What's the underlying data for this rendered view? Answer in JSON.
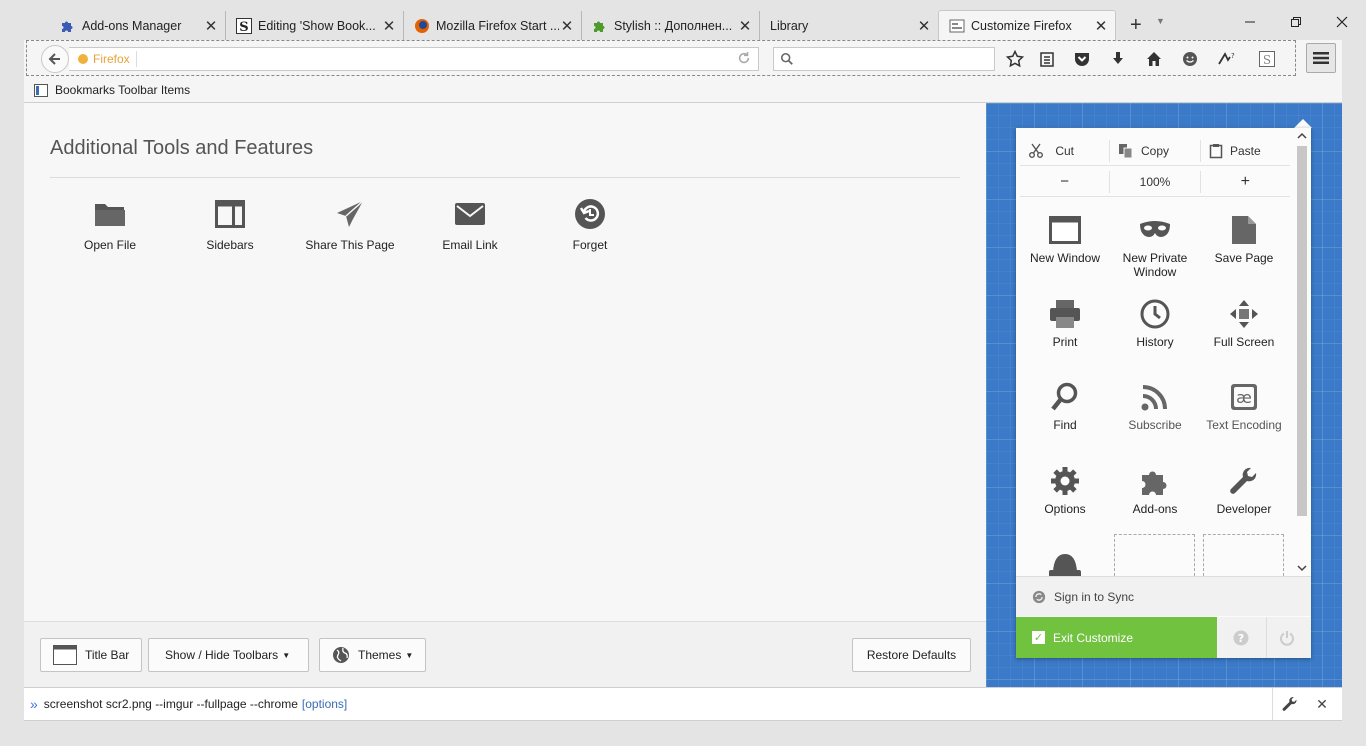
{
  "tabs": [
    {
      "title": "Add-ons Manager",
      "icon": "puzzle-icon"
    },
    {
      "title": "Editing 'Show Book...",
      "icon": "stylish-s-icon"
    },
    {
      "title": "Mozilla Firefox Start ...",
      "icon": "firefox-icon"
    },
    {
      "title": "Stylish :: Дополнен...",
      "icon": "puzzle-green-icon"
    },
    {
      "title": "Library",
      "icon": ""
    },
    {
      "title": "Customize Firefox",
      "icon": "customize-icon",
      "selected": true
    }
  ],
  "navbar": {
    "url_identity": "Firefox",
    "search_placeholder": ""
  },
  "bookmarks_bar": {
    "label": "Bookmarks Toolbar Items"
  },
  "palette": {
    "heading": "Additional Tools and Features",
    "items": [
      {
        "label": "Open File",
        "icon": "folder-icon"
      },
      {
        "label": "Sidebars",
        "icon": "sidebar-icon"
      },
      {
        "label": "Share This Page",
        "icon": "share-icon"
      },
      {
        "label": "Email Link",
        "icon": "email-icon"
      },
      {
        "label": "Forget",
        "icon": "forget-icon"
      }
    ]
  },
  "footer": {
    "title_bar": "Title Bar",
    "show_hide_toolbars": "Show / Hide Toolbars",
    "themes": "Themes",
    "restore_defaults": "Restore Defaults"
  },
  "menu_panel": {
    "edit": {
      "cut": "Cut",
      "copy": "Copy",
      "paste": "Paste"
    },
    "zoom": {
      "minus": "−",
      "level": "100%",
      "plus": "+"
    },
    "items": [
      {
        "label": "New Window",
        "icon": "new-window-icon"
      },
      {
        "label": "New Private Window",
        "icon": "private-mask-icon"
      },
      {
        "label": "Save Page",
        "icon": "save-page-icon"
      },
      {
        "label": "Print",
        "icon": "printer-icon"
      },
      {
        "label": "History",
        "icon": "clock-icon"
      },
      {
        "label": "Full Screen",
        "icon": "fullscreen-icon"
      },
      {
        "label": "Find",
        "icon": "magnifier-icon"
      },
      {
        "label": "Subscribe",
        "icon": "rss-icon"
      },
      {
        "label": "Text Encoding",
        "icon": "text-encoding-icon"
      },
      {
        "label": "Options",
        "icon": "gear-icon"
      },
      {
        "label": "Add-ons",
        "icon": "puzzle-icon"
      },
      {
        "label": "Developer",
        "icon": "wrench-icon"
      }
    ],
    "sync_label": "Sign in to Sync",
    "exit_customize": "Exit Customize"
  },
  "devbar": {
    "prompt": "»",
    "command": "screenshot scr2.png --imgur --fullpage --chrome",
    "options": "[options]"
  },
  "colors": {
    "exit_green": "#71c23f",
    "blue_bg": "#3b7ac8",
    "link_blue": "#3a6db3"
  }
}
